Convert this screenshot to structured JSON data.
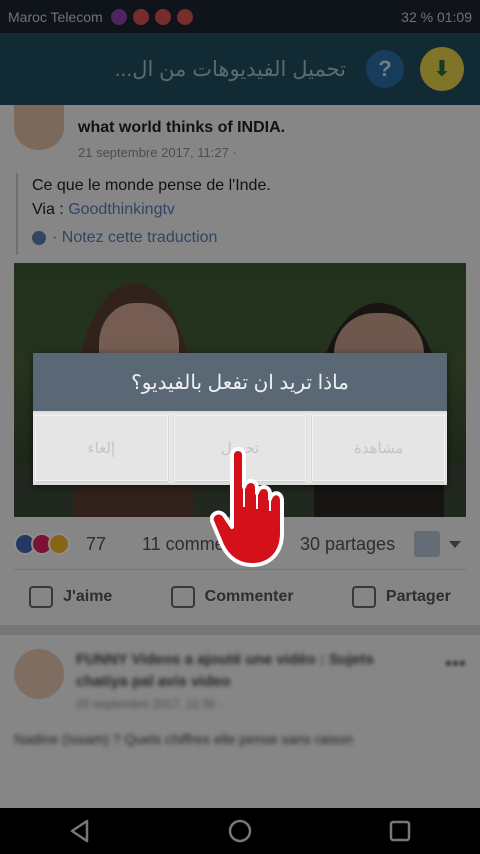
{
  "status_bar": {
    "carrier": "Maroc Telecom",
    "right_text": "32 % 01:09"
  },
  "app_bar": {
    "title": "تحميل الفيديوهات من ال..."
  },
  "post": {
    "headline": "what world thinks of INDIA.",
    "date": "21 septembre 2017, 11:27 · ",
    "text": "Ce que le monde pense de l'Inde.",
    "via_label": "Via :",
    "via_link": "Goodthinkingtv",
    "rate_translation": "· Notez cette traduction",
    "reactions_count": "77",
    "comments": "11 commentaires",
    "shares": "30 partages",
    "actions": {
      "like": "J'aime",
      "comment": "Commenter",
      "share": "Partager"
    }
  },
  "post2": {
    "line1": "FUNNY Videos a ajouté une vidéo : Sujets",
    "line2": "chatiya pal avis video",
    "line3": "20 septembre 2017, 11:30 · ",
    "line4": "Nadine (Issam) ? Quels chiffres elle pense sans raison"
  },
  "dialog": {
    "title": "ماذا تريد ان تفعل بالفيديو؟",
    "cancel": "إلغاء",
    "download": "تحميل",
    "watch": "مشاهدة"
  },
  "colors": {
    "app_bar": "#1f4d5f",
    "dialog_title": "#5a6876"
  }
}
